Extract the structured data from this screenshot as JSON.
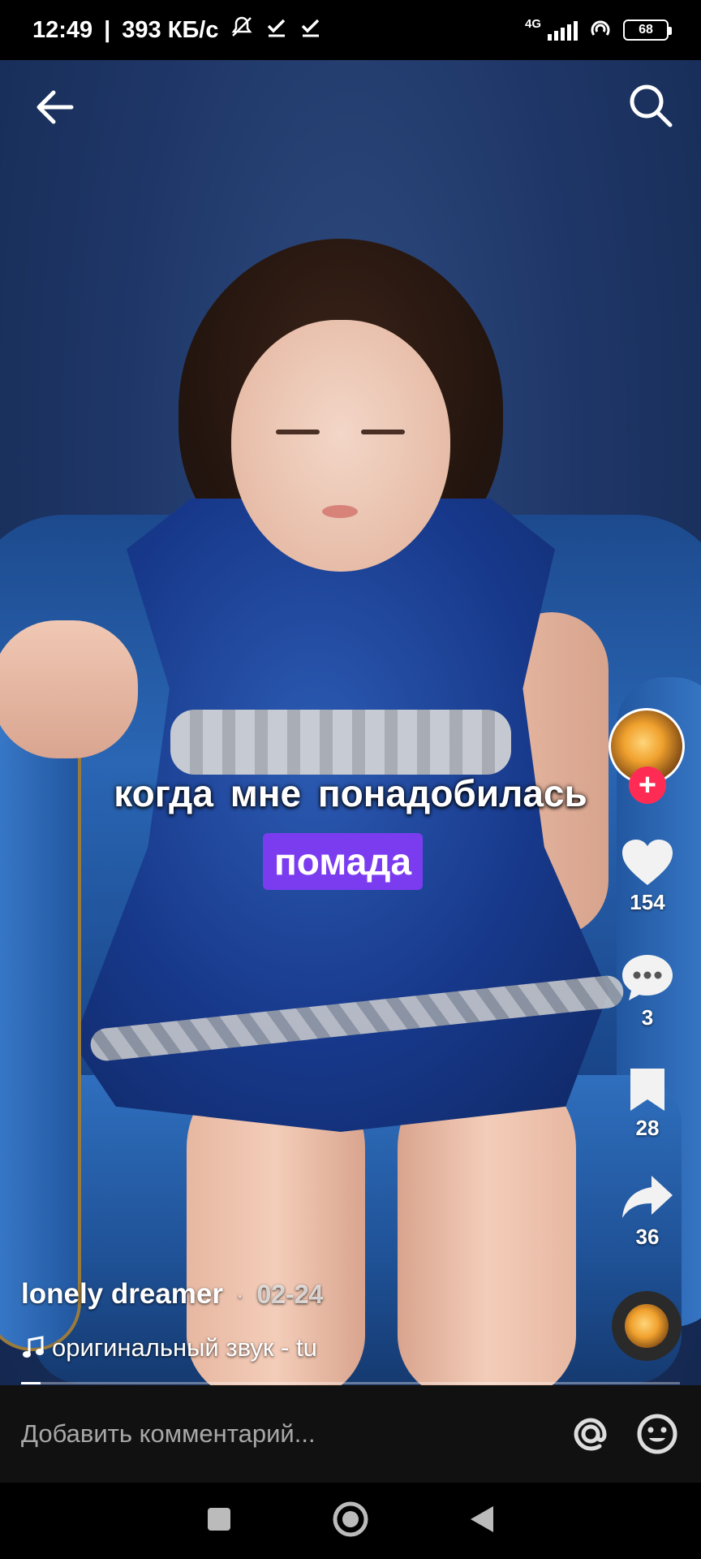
{
  "status_bar": {
    "time": "12:49",
    "speed": "393 КБ/с",
    "network": "4G",
    "battery": "68",
    "icons": [
      "bell-off-icon",
      "check-icon",
      "check-icon",
      "signal-icon",
      "hotspot-icon",
      "battery-icon"
    ]
  },
  "top_bar": {
    "back_icon": "arrow-left-icon",
    "search_icon": "search-icon"
  },
  "caption": {
    "line1": "когда  мне  понадобилась",
    "highlight": "помада",
    "highlight_color": "#7b3cf0"
  },
  "rail": {
    "follow_label": "+",
    "likes": "154",
    "comments": "3",
    "saves": "28",
    "shares": "36",
    "icons": [
      "heart-icon",
      "comment-icon",
      "bookmark-icon",
      "share-icon",
      "music-disc-icon"
    ]
  },
  "post": {
    "author": "lonely dreamer",
    "separator": "·",
    "date": "02-24",
    "sound_icon": "music-note-icon",
    "sound": "оригинальный звук - tu",
    "progress": 0.03
  },
  "comment_bar": {
    "placeholder": "Добавить комментарий...",
    "icons": [
      "at-icon",
      "emoji-icon"
    ]
  },
  "nav_bar": {
    "icons": [
      "recents-square-icon",
      "home-circle-icon",
      "back-triangle-icon"
    ]
  },
  "colors": {
    "follow_badge": "#fe2c55",
    "background": "#000000"
  }
}
